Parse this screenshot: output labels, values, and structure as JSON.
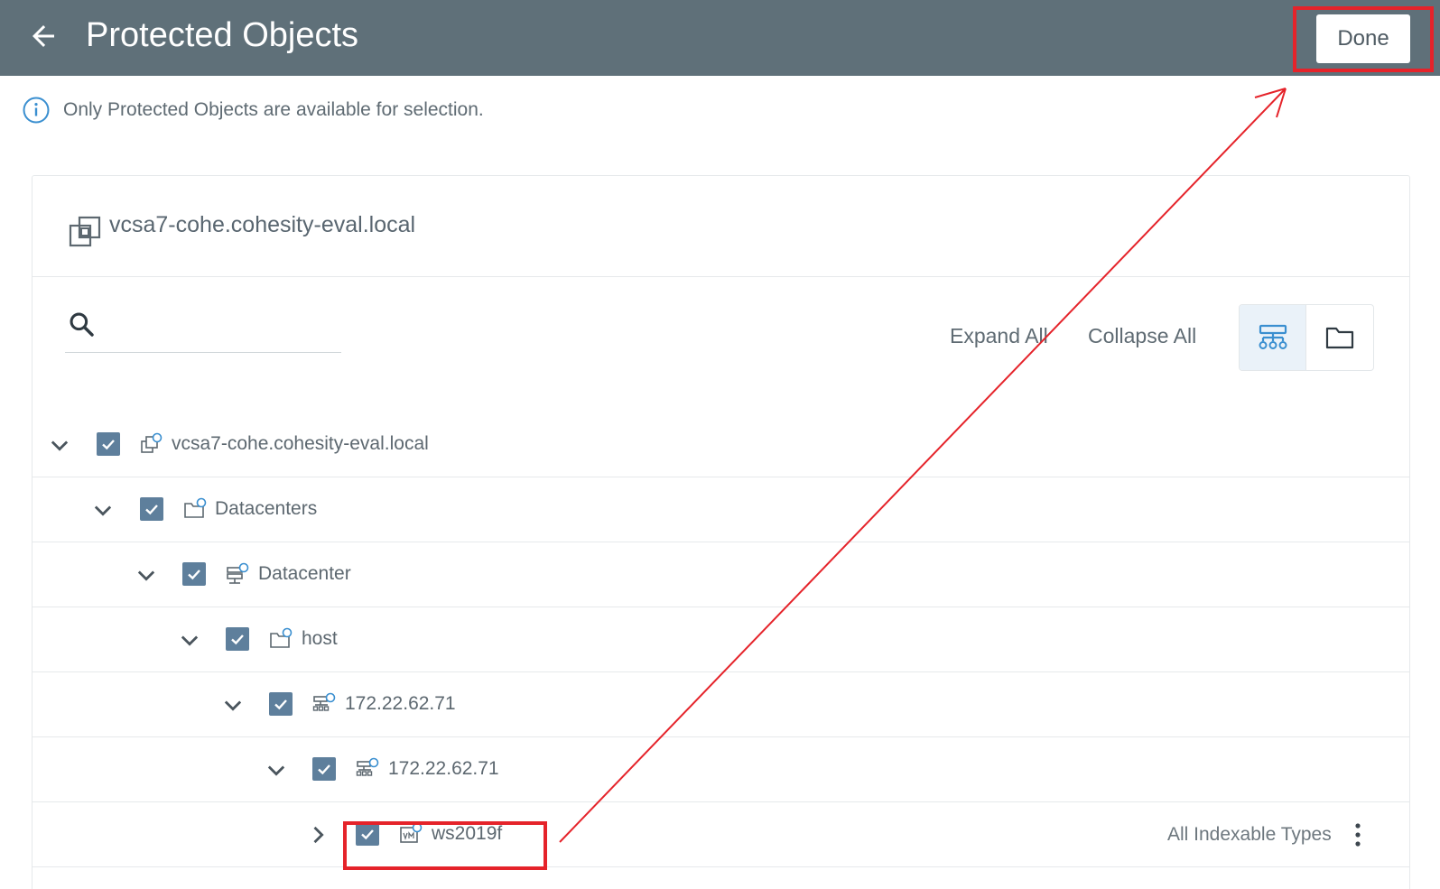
{
  "header": {
    "title": "Protected Objects",
    "done_label": "Done"
  },
  "info": {
    "message": "Only Protected Objects are available for selection."
  },
  "source": {
    "name": "vcsa7-cohe.cohesity-eval.local"
  },
  "toolbar": {
    "search_placeholder": "",
    "expand_all": "Expand All",
    "collapse_all": "Collapse All"
  },
  "tree": [
    {
      "label": "vcsa7-cohe.cohesity-eval.local",
      "checked": true,
      "expanded": true
    },
    {
      "label": "Datacenters",
      "checked": true,
      "expanded": true
    },
    {
      "label": "Datacenter",
      "checked": true,
      "expanded": true
    },
    {
      "label": "host",
      "checked": true,
      "expanded": true
    },
    {
      "label": "172.22.62.71",
      "checked": true,
      "expanded": true
    },
    {
      "label": "172.22.62.71",
      "checked": true,
      "expanded": true
    },
    {
      "label": "ws2019f",
      "checked": true,
      "expanded": false,
      "right_text": "All Indexable Types"
    }
  ],
  "colors": {
    "topbar": "#5f7079",
    "checkbox": "#5e7f9c",
    "annotation": "#e5232a",
    "accent": "#3a8fd0"
  }
}
